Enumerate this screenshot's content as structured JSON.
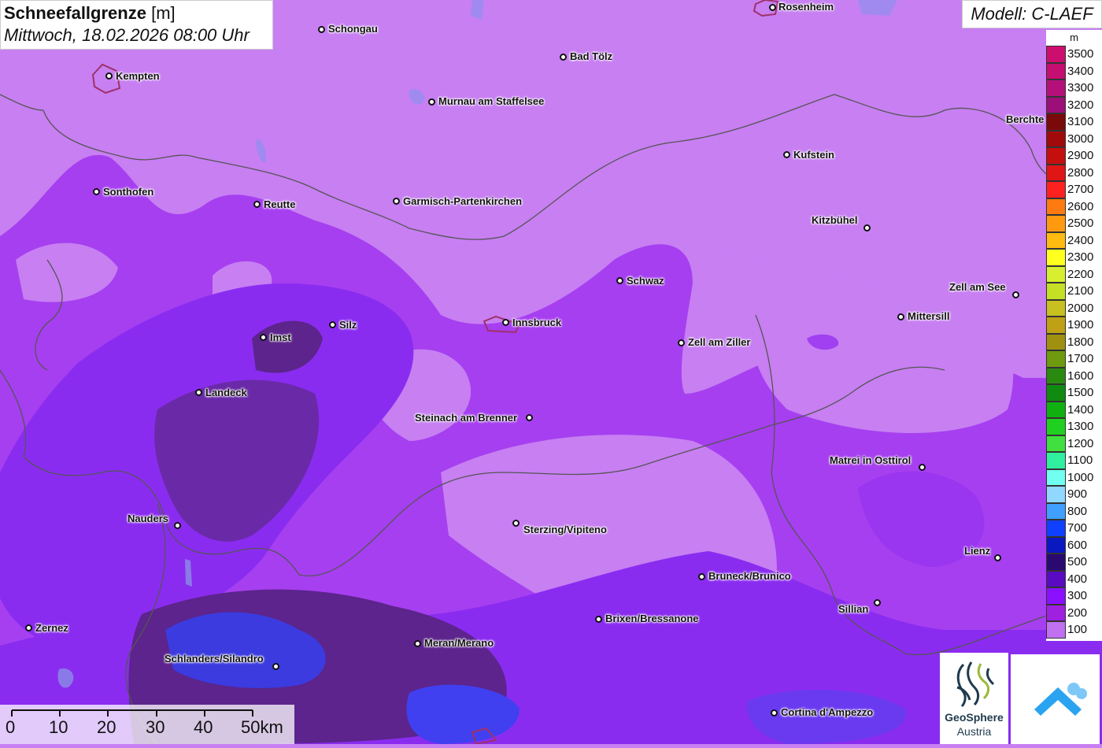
{
  "title": {
    "main": "Schneefallgrenze",
    "unit": "[m]",
    "datetime": "Mittwoch, 18.02.2026 08:00 Uhr"
  },
  "model": "Modell: C-LAEF",
  "legend": {
    "unit": "m",
    "entries": [
      {
        "label": "3500",
        "color": "#cc0e6e"
      },
      {
        "label": "3400",
        "color": "#c40e70"
      },
      {
        "label": "3300",
        "color": "#b5107a"
      },
      {
        "label": "3200",
        "color": "#9c0f78"
      },
      {
        "label": "3100",
        "color": "#7a0a0a"
      },
      {
        "label": "3000",
        "color": "#a00a0a"
      },
      {
        "label": "2900",
        "color": "#c50f0f"
      },
      {
        "label": "2800",
        "color": "#e01515"
      },
      {
        "label": "2700",
        "color": "#ff2020"
      },
      {
        "label": "2600",
        "color": "#ff7a10"
      },
      {
        "label": "2500",
        "color": "#ff9a10"
      },
      {
        "label": "2400",
        "color": "#ffbb10"
      },
      {
        "label": "2300",
        "color": "#ffff20"
      },
      {
        "label": "2200",
        "color": "#d8ee30"
      },
      {
        "label": "2100",
        "color": "#c5df25"
      },
      {
        "label": "2000",
        "color": "#c8c020"
      },
      {
        "label": "1900",
        "color": "#c0a015"
      },
      {
        "label": "1800",
        "color": "#a09010"
      },
      {
        "label": "1700",
        "color": "#6e9a10"
      },
      {
        "label": "1600",
        "color": "#2a8a10"
      },
      {
        "label": "1500",
        "color": "#108a10"
      },
      {
        "label": "1400",
        "color": "#10b010"
      },
      {
        "label": "1300",
        "color": "#20d020"
      },
      {
        "label": "1200",
        "color": "#40e040"
      },
      {
        "label": "1100",
        "color": "#30f0a0"
      },
      {
        "label": "1000",
        "color": "#70fff0"
      },
      {
        "label": "900",
        "color": "#90d8ff"
      },
      {
        "label": "800",
        "color": "#40a0ff"
      },
      {
        "label": "700",
        "color": "#1040ff"
      },
      {
        "label": "600",
        "color": "#0a18c0"
      },
      {
        "label": "500",
        "color": "#2a0a70"
      },
      {
        "label": "400",
        "color": "#5a0ac0"
      },
      {
        "label": "300",
        "color": "#8a10ff"
      },
      {
        "label": "200",
        "color": "#a020e0"
      },
      {
        "label": "100",
        "color": "#c070f0"
      }
    ]
  },
  "cities": [
    {
      "name": "Rosenheim"
    },
    {
      "name": "Schongau"
    },
    {
      "name": "Kempten"
    },
    {
      "name": "Bad Tölz"
    },
    {
      "name": "Murnau am Staffelsee"
    },
    {
      "name": "Berchte"
    },
    {
      "name": "Kufstein"
    },
    {
      "name": "Sonthofen"
    },
    {
      "name": "Reutte"
    },
    {
      "name": "Garmisch-Partenkirchen"
    },
    {
      "name": "Kitzbühel"
    },
    {
      "name": "Schwaz"
    },
    {
      "name": "Zell am See"
    },
    {
      "name": "Mittersill"
    },
    {
      "name": "Imst"
    },
    {
      "name": "Silz"
    },
    {
      "name": "Innsbruck"
    },
    {
      "name": "Zell am Ziller"
    },
    {
      "name": "Landeck"
    },
    {
      "name": "Steinach am Brenner"
    },
    {
      "name": "Matrei in Osttirol"
    },
    {
      "name": "Nauders"
    },
    {
      "name": "Sterzing/Vipiteno"
    },
    {
      "name": "Lienz"
    },
    {
      "name": "Bruneck/Brunico"
    },
    {
      "name": "Sillian"
    },
    {
      "name": "Brixen/Bressanone"
    },
    {
      "name": "Zernez"
    },
    {
      "name": "Meran/Merano"
    },
    {
      "name": "Schlanders/Silandro"
    },
    {
      "name": "Cortina d'Ampezzo"
    }
  ],
  "scalebar": {
    "labels": [
      "0",
      "10",
      "20",
      "30",
      "40",
      "50km"
    ]
  },
  "logos": {
    "geosphere_line1": "GeoSphere",
    "geosphere_line2": "Austria"
  }
}
